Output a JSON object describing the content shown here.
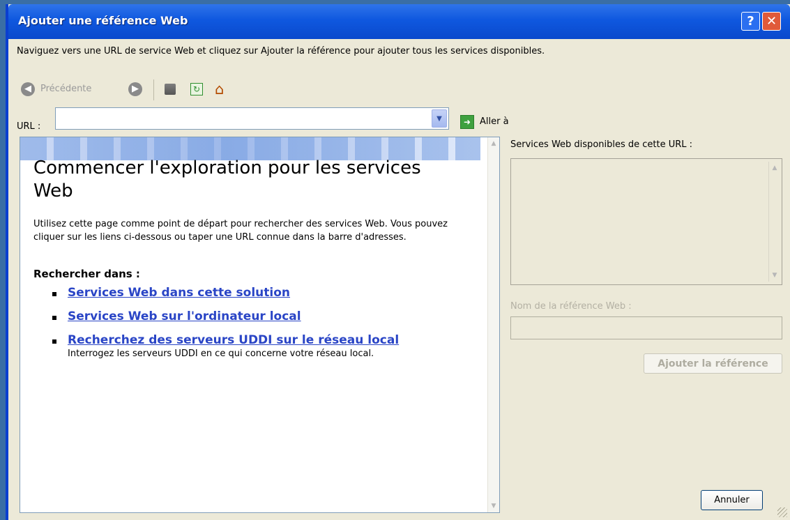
{
  "window": {
    "title": "Ajouter une référence Web",
    "help_glyph": "?",
    "close_glyph": "✕"
  },
  "instruction": "Naviguez vers une URL de service Web et cliquez sur Ajouter la référence pour ajouter tous les services disponibles.",
  "toolbar": {
    "back_label": "Précédente",
    "icons": [
      "back-arrow-icon",
      "forward-arrow-icon",
      "stop-icon",
      "refresh-icon",
      "home-icon"
    ]
  },
  "url_bar": {
    "label": "URL :",
    "value": "",
    "go_label": "Aller à"
  },
  "browser": {
    "heading": "Commencer l'exploration pour les services Web",
    "intro": "Utilisez cette page comme point de départ pour rechercher des services Web. Vous pouvez cliquer sur les liens ci-dessous ou taper une URL connue dans la barre d'adresses.",
    "search_title": "Rechercher dans :",
    "links": [
      {
        "label": "Services Web dans cette solution"
      },
      {
        "label": "Services Web sur l'ordinateur local"
      },
      {
        "label": "Recherchez des serveurs UDDI sur le réseau local",
        "description": "Interrogez les serveurs UDDI en ce qui concerne votre réseau local."
      }
    ]
  },
  "right_panel": {
    "services_label": "Services Web disponibles de cette URL :",
    "ref_name_label": "Nom de la référence Web :",
    "ref_name_value": "",
    "add_button": "Ajouter la référence",
    "cancel_button": "Annuler"
  },
  "colors": {
    "title_bar": "#0f58df",
    "link": "#2a45c6",
    "dialog_bg": "#ece9d8"
  }
}
